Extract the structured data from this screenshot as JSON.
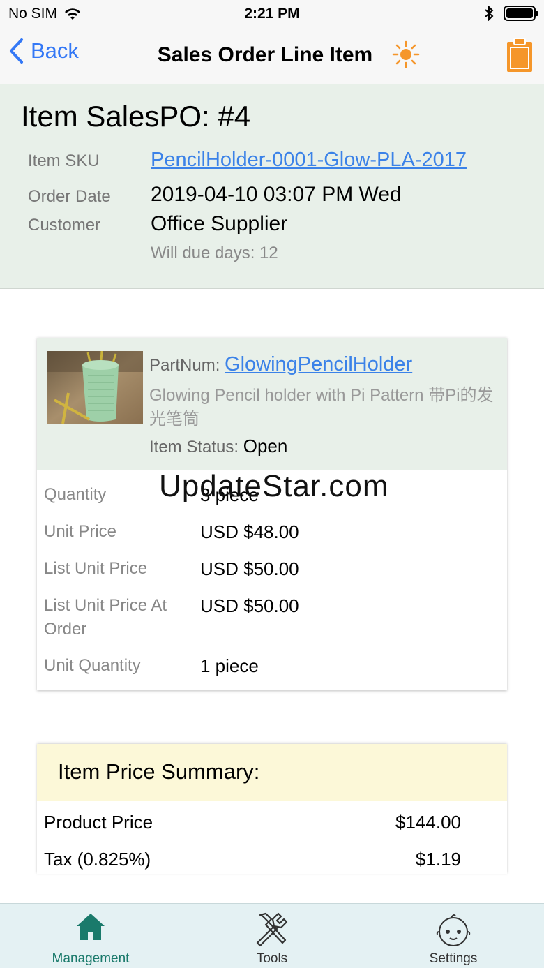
{
  "status_bar": {
    "carrier": "No SIM",
    "time": "2:21 PM"
  },
  "nav": {
    "back_label": "Back",
    "title": "Sales Order Line Item"
  },
  "header": {
    "title": "Item SalesPO: #4",
    "sku_label": "Item SKU",
    "sku_value": "PencilHolder-0001-Glow-PLA-2017",
    "order_date_label": "Order Date",
    "order_date_value": "2019-04-10 03:07 PM Wed",
    "customer_label": "Customer",
    "customer_value": "Office Supplier",
    "due_text": "Will due days: 12"
  },
  "item_card": {
    "partnum_label": "PartNum:",
    "partnum_value": "GlowingPencilHolder",
    "description": "Glowing Pencil holder with Pi Pattern 带Pi的发光笔筒",
    "status_label": "Item Status:",
    "status_value": "Open",
    "details": [
      {
        "label": "Quantity",
        "value": "3 piece"
      },
      {
        "label": "Unit Price",
        "value": "USD $48.00"
      },
      {
        "label": "List Unit Price",
        "value": "USD $50.00"
      },
      {
        "label": "List Unit Price At Order",
        "value": "USD $50.00"
      },
      {
        "label": "Unit Quantity",
        "value": "1 piece"
      }
    ]
  },
  "watermark": "UpdateStar.com",
  "summary": {
    "title": "Item Price Summary:",
    "rows": [
      {
        "label": "Product Price",
        "value": "$144.00"
      },
      {
        "label": "Tax (0.825%)",
        "value": "$1.19"
      }
    ]
  },
  "tabs": [
    {
      "label": "Management",
      "icon": "house-icon"
    },
    {
      "label": "Tools",
      "icon": "tools-icon"
    },
    {
      "label": "Settings",
      "icon": "baby-face-icon"
    }
  ],
  "colors": {
    "link": "#3b82e8",
    "ios_blue": "#3478f6",
    "header_bg": "#e8f0e9",
    "summary_bg": "#fcf8d8",
    "tab_bar_bg": "#e4f1f3",
    "active_tab": "#1a7a6b",
    "accent_orange": "#f5962a"
  }
}
